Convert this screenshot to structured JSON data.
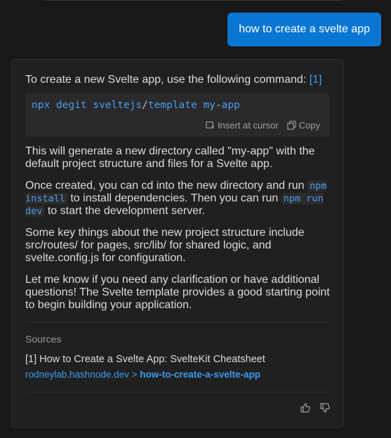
{
  "user_message": "how to create a svelte app",
  "answer": {
    "intro": "To create a new Svelte app, use the following command:",
    "citation": "[1]",
    "code": {
      "tokens": [
        "npx degit sveltejs",
        "/",
        "template my",
        "-",
        "app"
      ],
      "insert_label": "Insert at cursor",
      "copy_label": "Copy"
    },
    "para1": "This will generate a new directory called \"my-app\" with the default project structure and files for a Svelte app.",
    "para2_a": "Once created, you can cd into the new directory and run",
    "para2_code1": "npm install",
    "para2_b": "to install dependencies. Then you can run",
    "para2_code2": "npm run dev",
    "para2_c": "to start the development server.",
    "para3": "Some key things about the new project structure include src/routes/ for pages, src/lib/ for shared logic, and svelte.config.js for configuration.",
    "para4": "Let me know if you need any clarification or have additional questions! The Svelte template provides a good starting point to begin building your application."
  },
  "sources": {
    "label": "Sources",
    "items": [
      {
        "title": "[1] How to Create a Svelte App: SvelteKit Cheatsheet",
        "host": "rodneylab.hashnode.dev",
        "sep": " > ",
        "path": "how-to-create-a-svelte-app"
      }
    ]
  },
  "feedback": {
    "up_icon": "thumbs-up-icon",
    "down_icon": "thumbs-down-icon"
  },
  "colors": {
    "accent": "#0a76d4",
    "link": "#3b9cf0",
    "background": "#181818",
    "card": "#202020"
  }
}
